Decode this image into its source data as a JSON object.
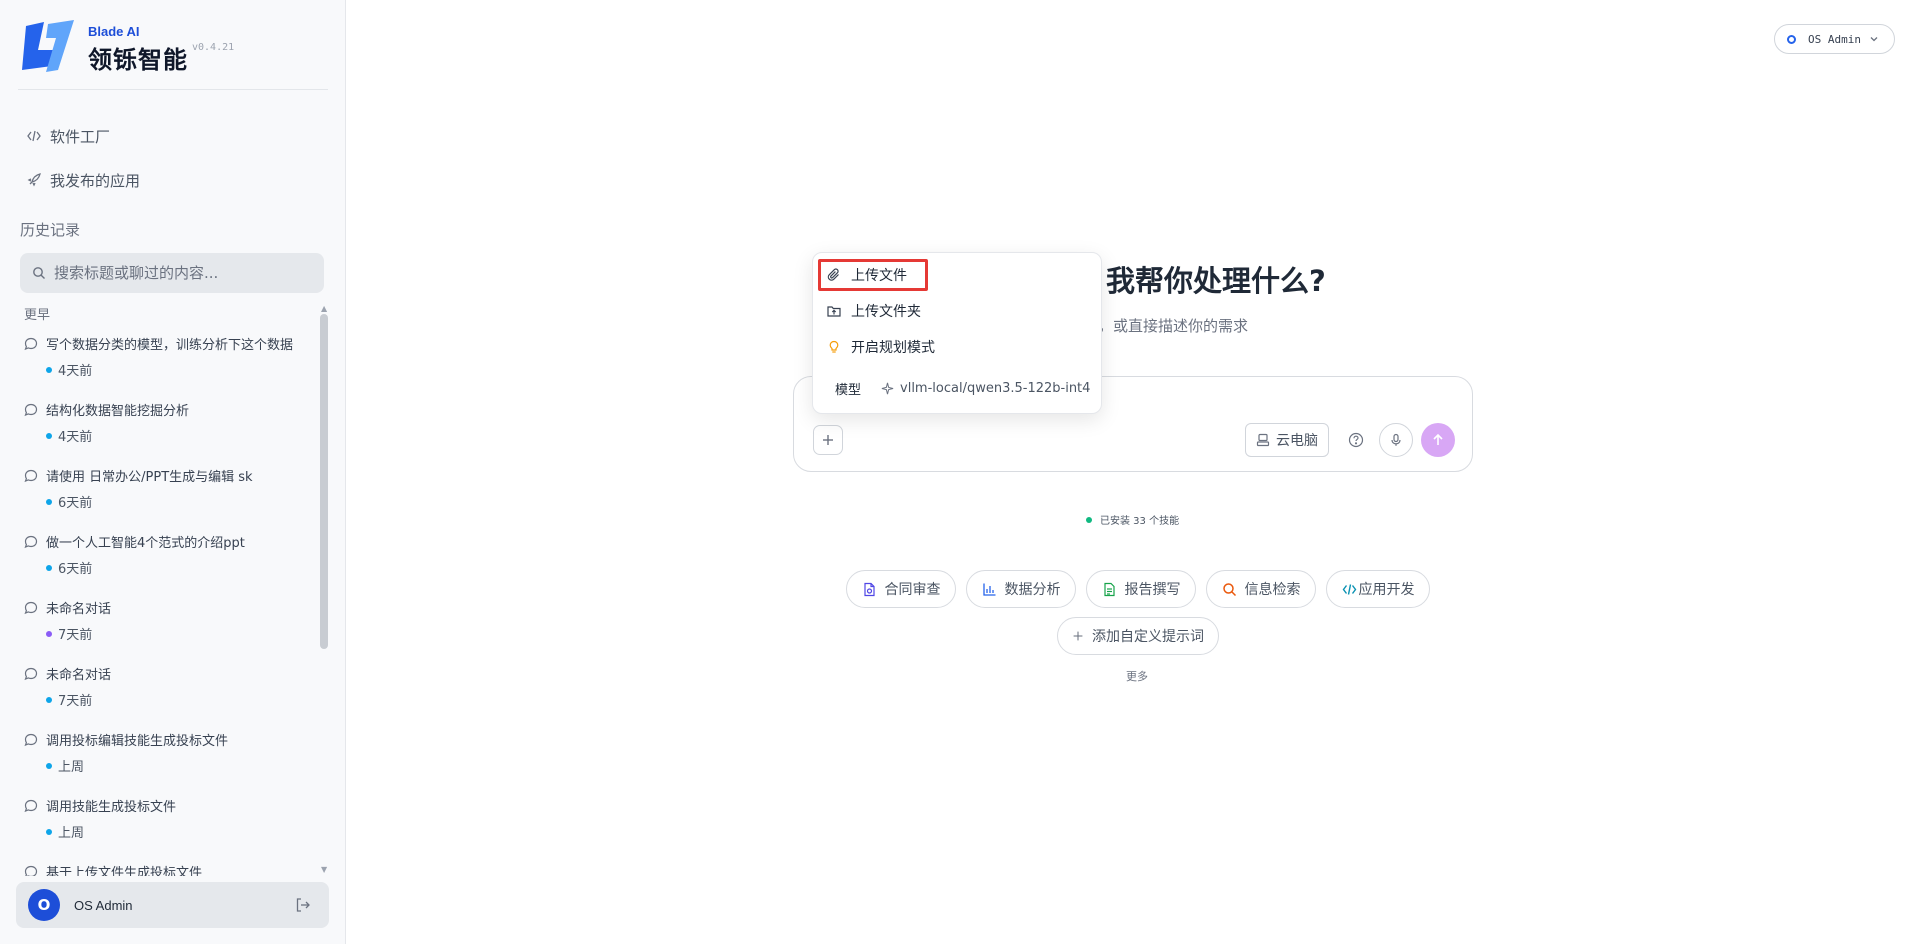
{
  "brand": {
    "name_en": "Blade AI",
    "name_cn": "领铄智能",
    "version": "v0.4.21"
  },
  "nav": {
    "factory": "软件工厂",
    "apps": "我发布的应用"
  },
  "history": {
    "title": "历史记录",
    "search_placeholder": "搜索标题或聊过的内容...",
    "group": "更早",
    "items": [
      {
        "title": "写个数据分类的模型，训练分析下这个数据",
        "time": "4天前",
        "dot": "#0ea5e9"
      },
      {
        "title": "结构化数据智能挖掘分析",
        "time": "4天前",
        "dot": "#0ea5e9"
      },
      {
        "title": "请使用 日常办公/PPT生成与编辑 sk",
        "time": "6天前",
        "dot": "#0ea5e9"
      },
      {
        "title": "做一个人工智能4个范式的介绍ppt",
        "time": "6天前",
        "dot": "#0ea5e9"
      },
      {
        "title": "未命名对话",
        "time": "7天前",
        "dot": "#8b5cf6"
      },
      {
        "title": "未命名对话",
        "time": "7天前",
        "dot": "#0ea5e9"
      },
      {
        "title": "调用投标编辑技能生成投标文件",
        "time": "上周",
        "dot": "#0ea5e9"
      },
      {
        "title": "调用技能生成投标文件",
        "time": "上周",
        "dot": "#0ea5e9"
      },
      {
        "title": "基于上传文件生成投标文件",
        "time": "",
        "dot": "#0ea5e9"
      }
    ]
  },
  "user": {
    "initial": "O",
    "name": "OS Admin"
  },
  "top_right": {
    "label": "OS Admin"
  },
  "hero": {
    "title": "我帮你处理什么?",
    "subtitle": "开始，或直接描述你的需求"
  },
  "popup": {
    "upload_file": "上传文件",
    "upload_folder": "上传文件夹",
    "plan_mode": "开启规划模式",
    "model_label": "模型",
    "model_value": "vllm-local/qwen3.5-122b-int4"
  },
  "composer": {
    "cloud_pc": "云电脑"
  },
  "status": {
    "text": "已安装 33 个技能"
  },
  "chips": {
    "contract": "合同审查",
    "data": "数据分析",
    "report": "报告撰写",
    "search": "信息检索",
    "dev": "应用开发",
    "add": "添加自定义提示词"
  },
  "more": "更多",
  "colors": {
    "accent": "#1d4ed8",
    "send": "#d8a7f5",
    "highlight": "#e53935",
    "status_dot": "#10b981"
  }
}
